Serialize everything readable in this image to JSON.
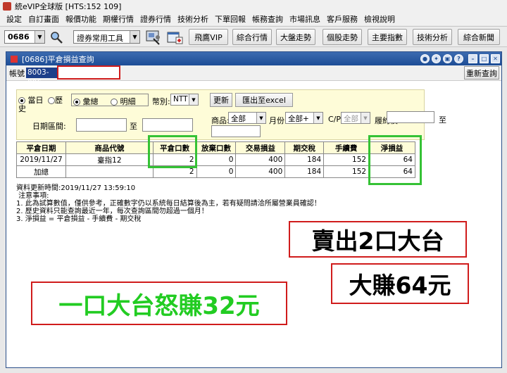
{
  "app": {
    "title": "統eVIP全球版  [HTS:152 109]"
  },
  "menu": [
    "設定",
    "自訂畫面",
    "報價功能",
    "期權行情",
    "證券行情",
    "技術分析",
    "下單回報",
    "帳務查詢",
    "市場訊息",
    "客戶服務",
    "檢視說明"
  ],
  "toolbar": {
    "stock_code": "0686",
    "tool_group": "證券常用工具",
    "buttons": [
      "飛鷹VIP",
      "綜合行情",
      "大盤走勢",
      "個股走勢",
      "主要指數",
      "技術分析",
      "綜合新聞"
    ]
  },
  "window": {
    "title": "[0686]平倉損益查詢",
    "account_label": "帳號",
    "account_value": "8003-006",
    "refresh_query": "重新查詢"
  },
  "filters": {
    "radio_today": "當日",
    "radio_history_a": "歷",
    "radio_history_b": "史",
    "radio_total": "彙總",
    "radio_detail": "明細",
    "currency_label": "幣別:",
    "currency_value": "NTT",
    "update_button": "更新",
    "export_button": "匯出至excel",
    "date_range_label": "日期區間:",
    "date_to": "至",
    "product_label": "商品:",
    "product_value": "全部",
    "month_label": "月份:",
    "month_value": "全部+",
    "cp_label": "C/P",
    "cp_value": "全部",
    "strike_label": "履約價",
    "strike_to": "至"
  },
  "table": {
    "headers": [
      "平倉日期",
      "商品代號",
      "平倉口數",
      "放棄口數",
      "交易損益",
      "期交稅",
      "手續費",
      "淨損益"
    ],
    "rows": [
      [
        "2019/11/27",
        "臺指12",
        "2",
        "0",
        "400",
        "184",
        "152",
        "64"
      ],
      [
        "加總",
        "",
        "2",
        "0",
        "400",
        "184",
        "152",
        "64"
      ]
    ]
  },
  "notes": {
    "updated": "資料更新時間:2019/11/27 13:59:10",
    "heading": " 注意事項:",
    "line1": "1. 此為試算數值，僅供參考，正確數字仍以系統每日結算後為主，若有疑問請洽所屬營業員確認！",
    "line2": "2. 歷史資料只能查詢最近一年，每次查詢區間勿超過一個月！",
    "line3": "3. 淨損益 = 平倉損益 - 手續費 - 期交稅"
  },
  "callouts": {
    "sell": "賣出2口大台",
    "earn": "大賺64元",
    "angry": "一口大台怒賺32元"
  },
  "colors": {
    "highlight_green": "#35c235",
    "callout_red": "#d01c1c",
    "callout_text_green": "#22cc22",
    "panel_yellow": "#fefcd8"
  }
}
